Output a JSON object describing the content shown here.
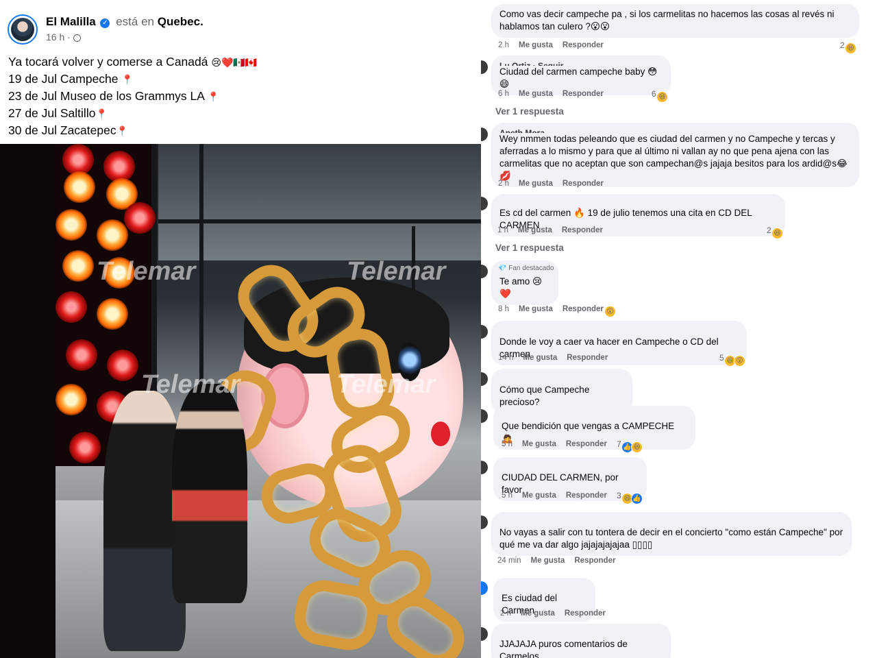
{
  "post": {
    "author": "El Malilla",
    "location_prefix": "está en",
    "location": "Quebec.",
    "time": "16 h ·",
    "lines": [
      {
        "text": "Ya tocará volver y comerse a Canadá",
        "emoji": "😢❤️🇲🇽🇨🇦"
      },
      {
        "text": "19 de Jul Campeche",
        "emoji": "📍"
      },
      {
        "text": "23 de Jul Museo de los Grammys LA",
        "emoji": "📍"
      },
      {
        "text": "27 de Jul Saltillo",
        "emoji": "📍"
      },
      {
        "text": "30 de Jul Zacatepec",
        "emoji": "📍"
      }
    ],
    "watermark": "Telemar"
  },
  "comments": [
    {
      "text": "Como vas decir campeche pa , si los carmelitas no hacemos las cosas al revés ni hablamos tan culero ?😮😮",
      "time": "2 h",
      "reactions": "2",
      "react_icons": [
        "haha"
      ]
    },
    {
      "name": "Lu Ortiz · Seguir",
      "text": "Ciudad del carmen campeche baby 😳😄",
      "time": "6 h",
      "reactions": "6",
      "react_icons": [
        "haha"
      ],
      "view_replies": "Ver 1 respuesta"
    },
    {
      "name": "Aneth Mora",
      "text": "Wey nmmen todas peleando que es ciudad del carmen y no Campeche y tercas y aferradas a lo mismo y para que al último ni vallan ay no que pena ajena con las carmelitas que no aceptan que son campechan@s jajaja besitos para los ardid@s😂💋",
      "time": "2 h",
      "reactions": ""
    },
    {
      "text": "Es cd del carmen 🔥 19 de julio tenemos una cita en CD DEL CARMEN",
      "time": "1 h",
      "reactions": "2",
      "react_icons": [
        "haha"
      ],
      "view_replies": "Ver 1 respuesta"
    },
    {
      "badge": "💎 Fan destacado",
      "text": "Te amo 😢❤️",
      "time": "8 h",
      "reactions": "",
      "react_icons": [
        "wow"
      ]
    },
    {
      "text": "Donde le voy a caer va hacer en Campeche o CD del carmen",
      "time": "14 h",
      "reactions": "5",
      "react_icons": [
        "haha",
        "wow"
      ]
    },
    {
      "text": "Cómo que Campeche precioso?",
      "time": "",
      "reactions": ""
    },
    {
      "text": "Que bendición que vengas a CAMPECHE 🙇",
      "time": "5 h",
      "reactions": "7",
      "react_icons": [
        "likeb",
        "haha"
      ]
    },
    {
      "text": "CIUDAD DEL CARMEN, por favor",
      "time": "5 h",
      "reactions": "3",
      "react_icons": [
        "haha",
        "likeb"
      ]
    },
    {
      "text": "No vayas a salir con tu tontera de decir en el concierto \"como están Campeche\" por qué me va dar algo jajajajajajaa ▯▯▯▯",
      "time": "24 min",
      "reactions": ""
    },
    {
      "text": "Es ciudad del Carmen",
      "time": "2 h",
      "reactions": ""
    },
    {
      "text": "JJAJAJA puros comentarios de Carmelos",
      "time": "",
      "reactions": ""
    }
  ],
  "labels": {
    "like": "Me gusta",
    "reply": "Responder"
  }
}
